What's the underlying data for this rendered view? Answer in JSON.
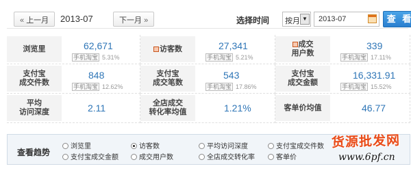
{
  "header": {
    "prev_label": "上一月",
    "period": "2013-07",
    "next_label": "下一月",
    "select_time_label": "选择时间",
    "granularity": "按月",
    "date_value": "2013-07",
    "search_label": "查 看"
  },
  "metrics": [
    {
      "label": "浏览里",
      "value": "62,671",
      "sub_tag": "手机淘宝",
      "sub_pct": "5.31%"
    },
    {
      "label": "访客数",
      "value": "27,341",
      "sub_tag": "手机淘宝",
      "sub_pct": "5.21%"
    },
    {
      "label_line1": "成交",
      "label_line2": "用户数",
      "value": "339",
      "sub_tag": "手机淘宝",
      "sub_pct": "17.11%"
    },
    {
      "label_line1": "支付宝",
      "label_line2": "成交件数",
      "value": "848",
      "sub_tag": "手机淘宝",
      "sub_pct": "12.62%"
    },
    {
      "label_line1": "支付宝",
      "label_line2": "成交笔数",
      "value": "543",
      "sub_tag": "手机淘宝",
      "sub_pct": "17.86%"
    },
    {
      "label_line1": "支付宝",
      "label_line2": "成交金额",
      "value": "16,331.91",
      "sub_tag": "手机淘宝",
      "sub_pct": "15.52%"
    },
    {
      "label_line1": "平均",
      "label_line2": "访问深度",
      "value": "2.11"
    },
    {
      "label_line1": "全店成交",
      "label_line2": "转化率均值",
      "value": "1.21%"
    },
    {
      "label": "客单价均值",
      "value": "46.77"
    }
  ],
  "trend": {
    "title": "查看趋势",
    "options": [
      "浏览里",
      "访客数",
      "平均访问深度",
      "支付宝成交件数",
      "支付宝成交金额",
      "成交用户数",
      "全店成交转化率",
      "客单价"
    ],
    "selected": "访客数"
  },
  "watermark": {
    "text": "货源批发网",
    "url": "www.6pf.cn"
  }
}
